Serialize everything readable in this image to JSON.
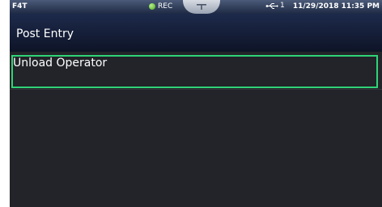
{
  "status_bar": {
    "device_name": "F4T",
    "rec_label": "REC",
    "usb_count": "1",
    "datetime": "11/29/2018 11:35 PM"
  },
  "page": {
    "title": "Post Entry"
  },
  "list": {
    "items": [
      {
        "label": "Unload Operator",
        "selected": true
      }
    ]
  },
  "colors": {
    "selection_border": "#2fd477",
    "rec_indicator": "#46a81c",
    "background": "#222429"
  }
}
